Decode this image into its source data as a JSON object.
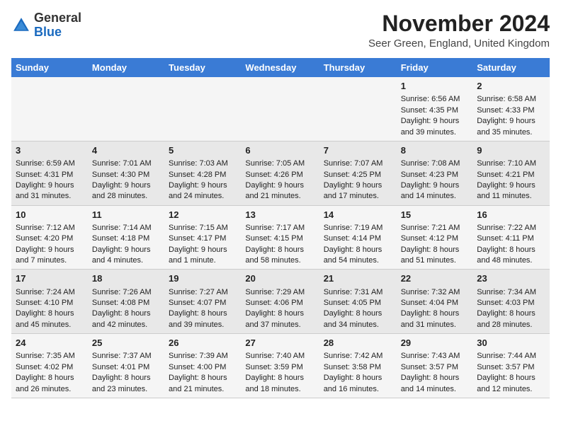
{
  "header": {
    "logo_general": "General",
    "logo_blue": "Blue",
    "month_title": "November 2024",
    "location": "Seer Green, England, United Kingdom"
  },
  "columns": [
    "Sunday",
    "Monday",
    "Tuesday",
    "Wednesday",
    "Thursday",
    "Friday",
    "Saturday"
  ],
  "weeks": [
    {
      "days": [
        {
          "num": "",
          "sunrise": "",
          "sunset": "",
          "daylight": ""
        },
        {
          "num": "",
          "sunrise": "",
          "sunset": "",
          "daylight": ""
        },
        {
          "num": "",
          "sunrise": "",
          "sunset": "",
          "daylight": ""
        },
        {
          "num": "",
          "sunrise": "",
          "sunset": "",
          "daylight": ""
        },
        {
          "num": "",
          "sunrise": "",
          "sunset": "",
          "daylight": ""
        },
        {
          "num": "1",
          "sunrise": "Sunrise: 6:56 AM",
          "sunset": "Sunset: 4:35 PM",
          "daylight": "Daylight: 9 hours and 39 minutes."
        },
        {
          "num": "2",
          "sunrise": "Sunrise: 6:58 AM",
          "sunset": "Sunset: 4:33 PM",
          "daylight": "Daylight: 9 hours and 35 minutes."
        }
      ]
    },
    {
      "days": [
        {
          "num": "3",
          "sunrise": "Sunrise: 6:59 AM",
          "sunset": "Sunset: 4:31 PM",
          "daylight": "Daylight: 9 hours and 31 minutes."
        },
        {
          "num": "4",
          "sunrise": "Sunrise: 7:01 AM",
          "sunset": "Sunset: 4:30 PM",
          "daylight": "Daylight: 9 hours and 28 minutes."
        },
        {
          "num": "5",
          "sunrise": "Sunrise: 7:03 AM",
          "sunset": "Sunset: 4:28 PM",
          "daylight": "Daylight: 9 hours and 24 minutes."
        },
        {
          "num": "6",
          "sunrise": "Sunrise: 7:05 AM",
          "sunset": "Sunset: 4:26 PM",
          "daylight": "Daylight: 9 hours and 21 minutes."
        },
        {
          "num": "7",
          "sunrise": "Sunrise: 7:07 AM",
          "sunset": "Sunset: 4:25 PM",
          "daylight": "Daylight: 9 hours and 17 minutes."
        },
        {
          "num": "8",
          "sunrise": "Sunrise: 7:08 AM",
          "sunset": "Sunset: 4:23 PM",
          "daylight": "Daylight: 9 hours and 14 minutes."
        },
        {
          "num": "9",
          "sunrise": "Sunrise: 7:10 AM",
          "sunset": "Sunset: 4:21 PM",
          "daylight": "Daylight: 9 hours and 11 minutes."
        }
      ]
    },
    {
      "days": [
        {
          "num": "10",
          "sunrise": "Sunrise: 7:12 AM",
          "sunset": "Sunset: 4:20 PM",
          "daylight": "Daylight: 9 hours and 7 minutes."
        },
        {
          "num": "11",
          "sunrise": "Sunrise: 7:14 AM",
          "sunset": "Sunset: 4:18 PM",
          "daylight": "Daylight: 9 hours and 4 minutes."
        },
        {
          "num": "12",
          "sunrise": "Sunrise: 7:15 AM",
          "sunset": "Sunset: 4:17 PM",
          "daylight": "Daylight: 9 hours and 1 minute."
        },
        {
          "num": "13",
          "sunrise": "Sunrise: 7:17 AM",
          "sunset": "Sunset: 4:15 PM",
          "daylight": "Daylight: 8 hours and 58 minutes."
        },
        {
          "num": "14",
          "sunrise": "Sunrise: 7:19 AM",
          "sunset": "Sunset: 4:14 PM",
          "daylight": "Daylight: 8 hours and 54 minutes."
        },
        {
          "num": "15",
          "sunrise": "Sunrise: 7:21 AM",
          "sunset": "Sunset: 4:12 PM",
          "daylight": "Daylight: 8 hours and 51 minutes."
        },
        {
          "num": "16",
          "sunrise": "Sunrise: 7:22 AM",
          "sunset": "Sunset: 4:11 PM",
          "daylight": "Daylight: 8 hours and 48 minutes."
        }
      ]
    },
    {
      "days": [
        {
          "num": "17",
          "sunrise": "Sunrise: 7:24 AM",
          "sunset": "Sunset: 4:10 PM",
          "daylight": "Daylight: 8 hours and 45 minutes."
        },
        {
          "num": "18",
          "sunrise": "Sunrise: 7:26 AM",
          "sunset": "Sunset: 4:08 PM",
          "daylight": "Daylight: 8 hours and 42 minutes."
        },
        {
          "num": "19",
          "sunrise": "Sunrise: 7:27 AM",
          "sunset": "Sunset: 4:07 PM",
          "daylight": "Daylight: 8 hours and 39 minutes."
        },
        {
          "num": "20",
          "sunrise": "Sunrise: 7:29 AM",
          "sunset": "Sunset: 4:06 PM",
          "daylight": "Daylight: 8 hours and 37 minutes."
        },
        {
          "num": "21",
          "sunrise": "Sunrise: 7:31 AM",
          "sunset": "Sunset: 4:05 PM",
          "daylight": "Daylight: 8 hours and 34 minutes."
        },
        {
          "num": "22",
          "sunrise": "Sunrise: 7:32 AM",
          "sunset": "Sunset: 4:04 PM",
          "daylight": "Daylight: 8 hours and 31 minutes."
        },
        {
          "num": "23",
          "sunrise": "Sunrise: 7:34 AM",
          "sunset": "Sunset: 4:03 PM",
          "daylight": "Daylight: 8 hours and 28 minutes."
        }
      ]
    },
    {
      "days": [
        {
          "num": "24",
          "sunrise": "Sunrise: 7:35 AM",
          "sunset": "Sunset: 4:02 PM",
          "daylight": "Daylight: 8 hours and 26 minutes."
        },
        {
          "num": "25",
          "sunrise": "Sunrise: 7:37 AM",
          "sunset": "Sunset: 4:01 PM",
          "daylight": "Daylight: 8 hours and 23 minutes."
        },
        {
          "num": "26",
          "sunrise": "Sunrise: 7:39 AM",
          "sunset": "Sunset: 4:00 PM",
          "daylight": "Daylight: 8 hours and 21 minutes."
        },
        {
          "num": "27",
          "sunrise": "Sunrise: 7:40 AM",
          "sunset": "Sunset: 3:59 PM",
          "daylight": "Daylight: 8 hours and 18 minutes."
        },
        {
          "num": "28",
          "sunrise": "Sunrise: 7:42 AM",
          "sunset": "Sunset: 3:58 PM",
          "daylight": "Daylight: 8 hours and 16 minutes."
        },
        {
          "num": "29",
          "sunrise": "Sunrise: 7:43 AM",
          "sunset": "Sunset: 3:57 PM",
          "daylight": "Daylight: 8 hours and 14 minutes."
        },
        {
          "num": "30",
          "sunrise": "Sunrise: 7:44 AM",
          "sunset": "Sunset: 3:57 PM",
          "daylight": "Daylight: 8 hours and 12 minutes."
        }
      ]
    }
  ]
}
